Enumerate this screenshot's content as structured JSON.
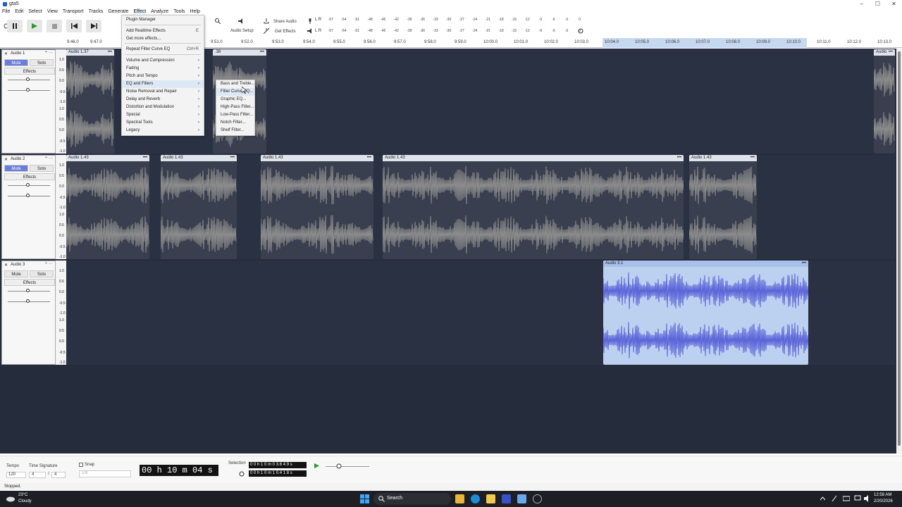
{
  "window": {
    "title": "gta5",
    "buttons": [
      "–",
      "☐",
      "✕"
    ]
  },
  "menubar": [
    "File",
    "Edit",
    "Select",
    "View",
    "Transport",
    "Tracks",
    "Generate",
    "Effect",
    "Analyze",
    "Tools",
    "Help"
  ],
  "toolbar": {
    "audio_setup": "Audio Setup",
    "share_audio": "Share Audio",
    "get_effects": "Get Effects",
    "meter_values": [
      "-57",
      "-54",
      "-51",
      "-48",
      "-45",
      "-42",
      "-39",
      "-36",
      "-33",
      "-30",
      "-27",
      "-24",
      "-21",
      "-18",
      "-15",
      "-12",
      "-9",
      "-6",
      "-3",
      "0"
    ],
    "meter_labels": {
      "top": "L R",
      "bottom": "L R"
    }
  },
  "ruler": [
    "9:46.0",
    "9:47.0",
    "9:51.0",
    "9:52.0",
    "9:53.0",
    "9:54.0",
    "9:55.0",
    "9:56.0",
    "9:57.0",
    "9:58.0",
    "9:59.0",
    "10:00.0",
    "10:01.0",
    "10:02.0",
    "10:03.0",
    "10:04.0",
    "10:05.0",
    "10:06.0",
    "10:07.0",
    "10:08.0",
    "10:09.0",
    "10:10.0",
    "10:11.0",
    "10:12.0",
    "10:13.0"
  ],
  "tracks": [
    {
      "name": "Audio 1",
      "mute": "Mute",
      "solo": "Solo",
      "effects": "Effects",
      "mute_on": true,
      "scale": [
        "1.0",
        "0.5",
        "0.0",
        "-0.5",
        "-1.0",
        "1.0",
        "0.5",
        "0.0",
        "-0.5",
        "-1.0"
      ],
      "clips": [
        {
          "label": "Audio 1.37"
        },
        {
          "label": ".38"
        },
        {
          "label": "Audio"
        }
      ]
    },
    {
      "name": "Audio 2",
      "mute": "Mute",
      "solo": "Solo",
      "effects": "Effects",
      "mute_on": true,
      "scale": [
        "1.0",
        "0.5",
        "0.0",
        "-0.5",
        "-1.0",
        "1.0",
        "0.5",
        "0.0",
        "-0.5",
        "-1.0"
      ],
      "clips": [
        {
          "label": "Audio 1.43"
        },
        {
          "label": "Audio 1.43"
        },
        {
          "label": "Audio 1.43"
        },
        {
          "label": "Audio 1.43"
        },
        {
          "label": "Audio 1.43"
        }
      ]
    },
    {
      "name": "Audio 3",
      "mute": "Mute",
      "solo": "Solo",
      "effects": "Effects",
      "mute_on": false,
      "scale": [
        "1.0",
        "0.5",
        "0.0",
        "-0.5",
        "-1.0",
        "1.0",
        "0.5",
        "0.0",
        "-0.5",
        "-1.0"
      ],
      "clips": [
        {
          "label": "Audio 3.1"
        }
      ]
    }
  ],
  "effect_menu": {
    "items": [
      {
        "label": "Plugin Manager"
      },
      {
        "label": "Add Realtime Effects",
        "shortcut": "E"
      },
      {
        "label": "Get more effects..."
      },
      {
        "label": "Repeat Filter Curve EQ",
        "shortcut": "Ctrl+R"
      },
      {
        "label": "Volume and Compression",
        "sub": true
      },
      {
        "label": "Fading",
        "sub": true
      },
      {
        "label": "Pitch and Tempo",
        "sub": true
      },
      {
        "label": "EQ and Filters",
        "sub": true
      },
      {
        "label": "Noise Removal and Repair",
        "sub": true
      },
      {
        "label": "Delay and Reverb",
        "sub": true
      },
      {
        "label": "Distortion and Modulation",
        "sub": true
      },
      {
        "label": "Special",
        "sub": true
      },
      {
        "label": "Spectral Tools",
        "sub": true
      },
      {
        "label": "Legacy",
        "sub": true
      }
    ]
  },
  "submenu": {
    "items": [
      "Bass and Treble...",
      "Filter Curve EQ...",
      "Graphic EQ...",
      "High-Pass Filter...",
      "Low-Pass Filter...",
      "Notch Filter...",
      "Shelf Filter..."
    ]
  },
  "bottom": {
    "tempo_label": "Tempo",
    "tempo_value": "120",
    "ts_label": "Time Signature",
    "ts_num": "4",
    "ts_den": "4",
    "snap_label": "Snap",
    "snap_value": "1/8",
    "time": "00 h 10 m 04 s",
    "selection_label": "Selection",
    "sel_start": "0 0 h 1 0 m 0 3.6 4 9 s",
    "sel_end": "0 0 h 1 0 m 1 0.4 1 8 s"
  },
  "status": "Stopped.",
  "taskbar": {
    "temp": "23°C",
    "weather": "Cloudy",
    "search": "Search",
    "time": "12:58 AM",
    "date": "2/20/2026"
  },
  "colors": {
    "accent": "#6b7dd8",
    "track_bg": "#2a3142",
    "waveform": "#8c8c8c",
    "selected_wave": "#5a63d8",
    "selected_bg": "#bcd0f0"
  }
}
